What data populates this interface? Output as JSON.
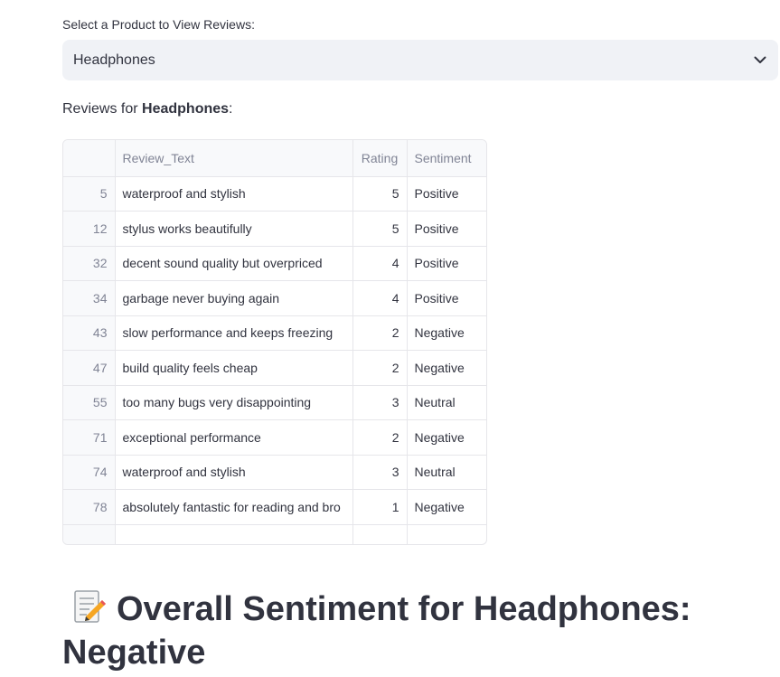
{
  "selector": {
    "label": "Select a Product to View Reviews:",
    "selected": "Headphones"
  },
  "reviews_heading": {
    "prefix": "Reviews for ",
    "product": "Headphones",
    "suffix": ":"
  },
  "table": {
    "columns": [
      "",
      "Review_Text",
      "Rating",
      "Sentiment"
    ],
    "rows": [
      {
        "index": "5",
        "text": "waterproof and stylish",
        "rating": "5",
        "sentiment": "Positive"
      },
      {
        "index": "12",
        "text": "stylus works beautifully",
        "rating": "5",
        "sentiment": "Positive"
      },
      {
        "index": "32",
        "text": "decent sound quality but overpriced",
        "rating": "4",
        "sentiment": "Positive"
      },
      {
        "index": "34",
        "text": "garbage never buying again",
        "rating": "4",
        "sentiment": "Positive"
      },
      {
        "index": "43",
        "text": "slow performance and keeps freezing",
        "rating": "2",
        "sentiment": "Negative"
      },
      {
        "index": "47",
        "text": "build quality feels cheap",
        "rating": "2",
        "sentiment": "Negative"
      },
      {
        "index": "55",
        "text": "too many bugs very disappointing",
        "rating": "3",
        "sentiment": "Neutral"
      },
      {
        "index": "71",
        "text": "exceptional performance",
        "rating": "2",
        "sentiment": "Negative"
      },
      {
        "index": "74",
        "text": "waterproof and stylish",
        "rating": "3",
        "sentiment": "Neutral"
      },
      {
        "index": "78",
        "text": "absolutely fantastic for reading and bro",
        "rating": "1",
        "sentiment": "Negative"
      }
    ]
  },
  "overall": {
    "icon": "memo-icon",
    "text": "Overall Sentiment for Headphones: Negative"
  }
}
